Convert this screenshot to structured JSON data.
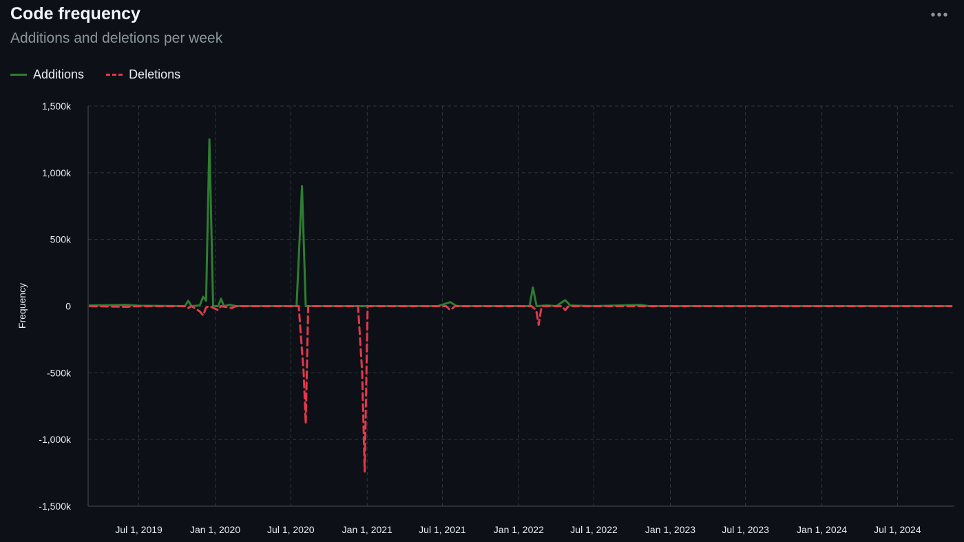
{
  "header": {
    "title": "Code frequency",
    "subtitle": "Additions and deletions per week",
    "more_icon": "kebab-horizontal-icon"
  },
  "colors": {
    "background": "#0d1117",
    "additions": "#2f7d32",
    "deletions": "#e5384c",
    "grid": "#30363d"
  },
  "chart_data": {
    "type": "line",
    "title": "",
    "ylabel": "Frequency",
    "xlabel": "",
    "ylim": [
      -1500000,
      1500000
    ],
    "xlim": [
      "2019-03-01",
      "2024-11-15"
    ],
    "y_ticks": [
      1500000,
      1000000,
      500000,
      0,
      -500000,
      -1000000,
      -1500000
    ],
    "y_tick_labels": [
      "1,500k",
      "1,000k",
      "500k",
      "0",
      "-500k",
      "-1,000k",
      "-1,500k"
    ],
    "x_ticks": [
      "2019-07-01",
      "2020-01-01",
      "2020-07-01",
      "2021-01-01",
      "2021-07-01",
      "2022-01-01",
      "2022-07-01",
      "2023-01-01",
      "2023-07-01",
      "2024-01-01",
      "2024-07-01"
    ],
    "x_tick_labels": [
      "Jul 1, 2019",
      "Jan 1, 2020",
      "Jul 1, 2020",
      "Jan 1, 2021",
      "Jul 1, 2021",
      "Jan 1, 2022",
      "Jul 1, 2022",
      "Jan 1, 2023",
      "Jul 1, 2023",
      "Jan 1, 2024",
      "Jul 1, 2024"
    ],
    "grid": true,
    "legend_position": "top-left",
    "series": [
      {
        "name": "Additions",
        "style": "solid",
        "points": [
          [
            "2019-03-05",
            5000
          ],
          [
            "2019-06-01",
            10000
          ],
          [
            "2019-07-01",
            3000
          ],
          [
            "2019-10-20",
            0
          ],
          [
            "2019-10-28",
            40000
          ],
          [
            "2019-11-05",
            0
          ],
          [
            "2019-11-25",
            5000
          ],
          [
            "2019-12-03",
            70000
          ],
          [
            "2019-12-10",
            40000
          ],
          [
            "2019-12-18",
            1250000
          ],
          [
            "2019-12-27",
            0
          ],
          [
            "2020-01-08",
            0
          ],
          [
            "2020-01-15",
            55000
          ],
          [
            "2020-01-22",
            0
          ],
          [
            "2020-02-05",
            10000
          ],
          [
            "2020-02-20",
            0
          ],
          [
            "2020-05-10",
            0
          ],
          [
            "2020-07-15",
            0
          ],
          [
            "2020-07-28",
            900000
          ],
          [
            "2020-08-06",
            0
          ],
          [
            "2020-12-01",
            0
          ],
          [
            "2021-01-01",
            0
          ],
          [
            "2021-06-20",
            0
          ],
          [
            "2021-07-20",
            30000
          ],
          [
            "2021-08-05",
            0
          ],
          [
            "2022-01-05",
            0
          ],
          [
            "2022-01-27",
            0
          ],
          [
            "2022-02-04",
            140000
          ],
          [
            "2022-02-13",
            0
          ],
          [
            "2022-03-10",
            5000
          ],
          [
            "2022-04-01",
            0
          ],
          [
            "2022-04-23",
            45000
          ],
          [
            "2022-05-05",
            5000
          ],
          [
            "2022-05-20",
            3000
          ],
          [
            "2022-07-01",
            0
          ],
          [
            "2022-10-20",
            10000
          ],
          [
            "2022-11-10",
            0
          ],
          [
            "2024-11-08",
            0
          ]
        ]
      },
      {
        "name": "Deletions",
        "style": "dashed",
        "points": [
          [
            "2019-03-05",
            0
          ],
          [
            "2019-06-01",
            -5000
          ],
          [
            "2019-07-01",
            0
          ],
          [
            "2019-10-20",
            0
          ],
          [
            "2019-10-28",
            -15000
          ],
          [
            "2019-11-05",
            0
          ],
          [
            "2019-11-25",
            -40000
          ],
          [
            "2019-12-03",
            -70000
          ],
          [
            "2019-12-10",
            -10000
          ],
          [
            "2019-12-18",
            0
          ],
          [
            "2020-01-08",
            -30000
          ],
          [
            "2020-01-15",
            0
          ],
          [
            "2020-02-10",
            -15000
          ],
          [
            "2020-02-20",
            0
          ],
          [
            "2020-07-20",
            0
          ],
          [
            "2020-08-01",
            -500000
          ],
          [
            "2020-08-06",
            -880000
          ],
          [
            "2020-08-12",
            0
          ],
          [
            "2020-12-10",
            0
          ],
          [
            "2020-12-20",
            -500000
          ],
          [
            "2020-12-26",
            -1240000
          ],
          [
            "2021-01-02",
            0
          ],
          [
            "2021-07-10",
            0
          ],
          [
            "2021-07-20",
            -30000
          ],
          [
            "2021-08-01",
            0
          ],
          [
            "2022-02-01",
            0
          ],
          [
            "2022-02-12",
            -30000
          ],
          [
            "2022-02-18",
            -140000
          ],
          [
            "2022-02-25",
            0
          ],
          [
            "2022-04-15",
            0
          ],
          [
            "2022-04-23",
            -30000
          ],
          [
            "2022-05-01",
            0
          ],
          [
            "2024-11-08",
            0
          ]
        ]
      }
    ]
  }
}
